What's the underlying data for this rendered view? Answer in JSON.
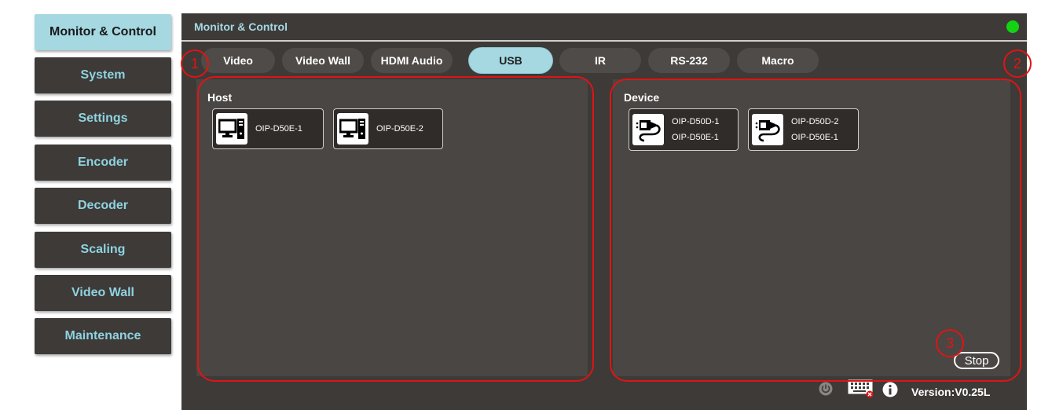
{
  "sidebar": {
    "items": [
      {
        "label": "Monitor & Control",
        "active": true
      },
      {
        "label": "System"
      },
      {
        "label": "Settings"
      },
      {
        "label": "Encoder"
      },
      {
        "label": "Decoder"
      },
      {
        "label": "Scaling"
      },
      {
        "label": "Video Wall"
      },
      {
        "label": "Maintenance"
      }
    ]
  },
  "main": {
    "title": "Monitor & Control",
    "status_color": "#13d413",
    "tabs": [
      {
        "label": "Video"
      },
      {
        "label": "Video Wall"
      },
      {
        "label": "HDMI Audio"
      },
      {
        "label": "USB",
        "active": true
      },
      {
        "label": "IR"
      },
      {
        "label": "RS-232"
      },
      {
        "label": "Macro"
      }
    ],
    "host": {
      "label": "Host",
      "items": [
        {
          "name": "OIP-D50E-1",
          "icon": "computer-icon"
        },
        {
          "name": "OIP-D50E-2",
          "icon": "computer-icon"
        }
      ]
    },
    "device": {
      "label": "Device",
      "items": [
        {
          "name": "OIP-D50D-1",
          "host": "OIP-D50E-1",
          "icon": "usb-cable-icon"
        },
        {
          "name": "OIP-D50D-2",
          "host": "OIP-D50E-1",
          "icon": "usb-cable-icon"
        }
      ]
    },
    "stop_label": "Stop"
  },
  "footer": {
    "version": "Version:V0.25L",
    "icons": [
      "power-icon",
      "keyboard-icon",
      "info-icon"
    ]
  },
  "annotations": [
    "1",
    "2",
    "3"
  ],
  "colors": {
    "accent": "#a6d8e2",
    "annotation": "#e01414",
    "panel": "#3d3a38"
  }
}
